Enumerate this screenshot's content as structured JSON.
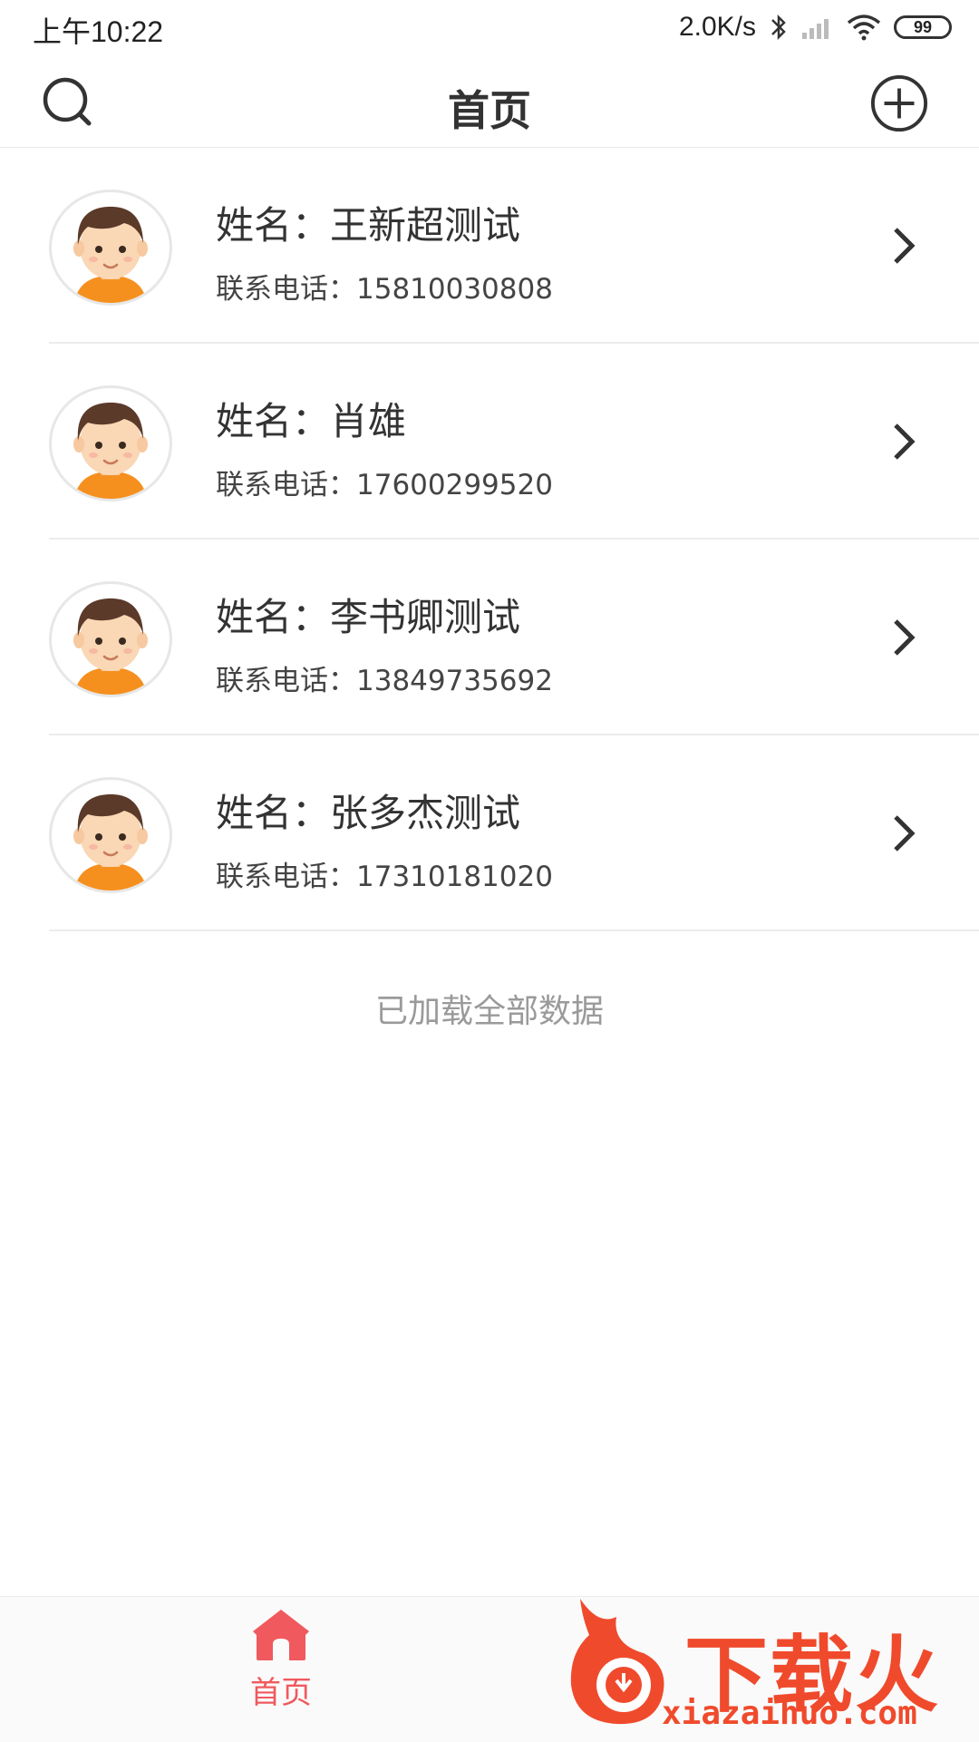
{
  "status_bar": {
    "time": "上午10:22",
    "net_speed": "2.0K/s",
    "battery": "99"
  },
  "header": {
    "title": "首页",
    "left_icon": "search-icon",
    "right_icon": "add-circle-icon"
  },
  "contacts": [
    {
      "name_label": "姓名：王新超测试",
      "phone_label": "联系电话：15810030808"
    },
    {
      "name_label": "姓名：肖雄",
      "phone_label": "联系电话：17600299520"
    },
    {
      "name_label": "姓名：李书卿测试",
      "phone_label": "联系电话：13849735692"
    },
    {
      "name_label": "姓名：张多杰测试",
      "phone_label": "联系电话：17310181020"
    }
  ],
  "list_footer": "已加载全部数据",
  "tabbar": {
    "home_label": "首页",
    "accent_color": "#f0595e"
  },
  "watermark": {
    "logo_text": "下载火",
    "url": "xiazaihuo.com"
  }
}
